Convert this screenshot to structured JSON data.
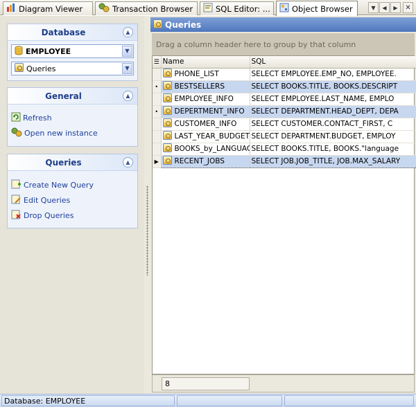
{
  "tabs": [
    {
      "label": "Diagram Viewer",
      "icon": "diagram-icon",
      "active": false
    },
    {
      "label": "Transaction Browser",
      "icon": "transaction-icon",
      "active": false
    },
    {
      "label": "SQL Editor: ...",
      "icon": "sql-editor-icon",
      "active": false
    },
    {
      "label": "Object Browser",
      "icon": "object-browser-icon",
      "active": true
    }
  ],
  "sidebar": {
    "database": {
      "title": "Database",
      "database_value": "EMPLOYEE",
      "object_type_value": "Queries"
    },
    "general": {
      "title": "General",
      "items": [
        {
          "label": "Refresh",
          "icon": "refresh-icon"
        },
        {
          "label": "Open new instance",
          "icon": "open-instance-icon"
        }
      ]
    },
    "queries": {
      "title": "Queries",
      "items": [
        {
          "label": "Create New Query",
          "icon": "create-query-icon"
        },
        {
          "label": "Edit Queries",
          "icon": "edit-queries-icon"
        },
        {
          "label": "Drop Queries",
          "icon": "drop-queries-icon"
        }
      ]
    }
  },
  "main": {
    "title": "Queries",
    "group_by_hint": "Drag a column header here to group by that column",
    "columns": [
      "Name",
      "SQL"
    ],
    "rows": [
      {
        "name": "PHONE_LIST",
        "sql": "SELECT EMPLOYEE.EMP_NO,      EMPLOYEE.",
        "marker": ""
      },
      {
        "name": "BESTSELLERS",
        "sql": "SELECT BOOKS.TITLE,      BOOKS.DESCRIPT",
        "marker": "•"
      },
      {
        "name": "EMPLOYEE_INFO",
        "sql": "SELECT EMPLOYEE.LAST_NAME,      EMPLO",
        "marker": ""
      },
      {
        "name": "DEPERTMENT_INFO",
        "sql": "SELECT DEPARTMENT.HEAD_DEPT,      DEPA",
        "marker": "•"
      },
      {
        "name": "CUSTOMER_INFO",
        "sql": "SELECT CUSTOMER.CONTACT_FIRST,      C",
        "marker": ""
      },
      {
        "name": "LAST_YEAR_BUDGET",
        "sql": "SELECT DEPARTMENT.BUDGET,      EMPLOY",
        "marker": ""
      },
      {
        "name": "BOOKS_by_LANGUAGE",
        "sql": "SELECT BOOKS.TITLE,      BOOKS.\"language",
        "marker": ""
      },
      {
        "name": "RECENT_JOBS",
        "sql": "SELECT JOB.JOB_TITLE, JOB.MAX_SALARY",
        "marker": "▶"
      }
    ],
    "record_count": "8"
  },
  "statusbar": {
    "text": "Database: EMPLOYEE"
  },
  "colors": {
    "panel_header": "#4f77bd",
    "selection": "#c7d7f0",
    "link": "#1d3f9a",
    "group_title": "#1f3f8a"
  }
}
